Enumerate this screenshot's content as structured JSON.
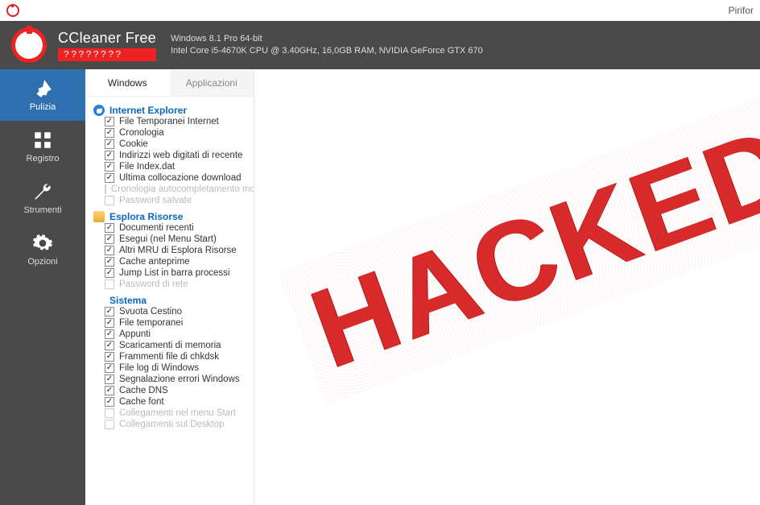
{
  "titlebar": {
    "brand": "Pirifor"
  },
  "header": {
    "title": "CCleaner Free",
    "version": "????????",
    "sys1": "Windows 8.1 Pro 64-bit",
    "sys2": "Intel Core i5-4670K CPU @ 3.40GHz, 16,0GB RAM, NVIDIA GeForce GTX 670"
  },
  "sidebar": {
    "items": [
      {
        "label": "Pulizia"
      },
      {
        "label": "Registro"
      },
      {
        "label": "Strumenti"
      },
      {
        "label": "Opzioni"
      }
    ]
  },
  "tabs": {
    "active": "Windows",
    "inactive": "Applicazioni"
  },
  "sections": {
    "ie": {
      "title": "Internet Explorer",
      "items": [
        {
          "label": "File Temporanei Internet",
          "checked": true
        },
        {
          "label": "Cronologia",
          "checked": true
        },
        {
          "label": "Cookie",
          "checked": true
        },
        {
          "label": "Indirizzi web digitati di recente",
          "checked": true
        },
        {
          "label": "File Index.dat",
          "checked": true
        },
        {
          "label": "Ultima collocazione download",
          "checked": true
        },
        {
          "label": "Cronologia autocompletamento mo",
          "checked": false
        },
        {
          "label": "Password salvate",
          "checked": false
        }
      ]
    },
    "explorer": {
      "title": "Esplora Risorse",
      "items": [
        {
          "label": "Documenti recenti",
          "checked": true
        },
        {
          "label": "Esegui (nel Menu Start)",
          "checked": true
        },
        {
          "label": "Altri MRU di Esplora Risorse",
          "checked": true
        },
        {
          "label": "Cache anteprime",
          "checked": true
        },
        {
          "label": "Jump List in barra processi",
          "checked": true
        },
        {
          "label": "Password di rete",
          "checked": false
        }
      ]
    },
    "sistema": {
      "title": "Sistema",
      "items": [
        {
          "label": "Svuota Cestino",
          "checked": true
        },
        {
          "label": "File temporanei",
          "checked": true
        },
        {
          "label": "Appunti",
          "checked": true
        },
        {
          "label": "Scaricamenti di memoria",
          "checked": true
        },
        {
          "label": "Frammenti file di chkdsk",
          "checked": true
        },
        {
          "label": "File log di Windows",
          "checked": true
        },
        {
          "label": "Segnalazione errori Windows",
          "checked": true
        },
        {
          "label": "Cache DNS",
          "checked": true
        },
        {
          "label": "Cache font",
          "checked": true
        },
        {
          "label": "Collegamenti nel menu Start",
          "checked": false
        },
        {
          "label": "Collegamenti sul Desktop",
          "checked": false
        }
      ]
    }
  },
  "overlay": {
    "stamp": "HACKED"
  }
}
